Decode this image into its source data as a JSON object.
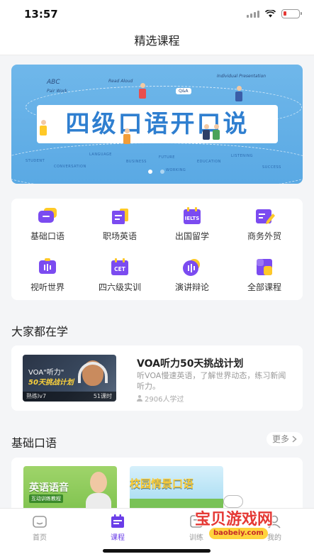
{
  "status_bar": {
    "time": "13:57"
  },
  "header": {
    "title": "精选课程"
  },
  "banner": {
    "title": "四级口语开口说",
    "small_texts": [
      "ABC",
      "Pair Work",
      "Read Aloud",
      "Individual Presentation",
      "Q&A"
    ],
    "words": [
      "STUDENT",
      "CONVERSATION",
      "LANGUAGE",
      "BUSINESS",
      "FUTURE",
      "WORKING",
      "EDUCATION",
      "LISTENING",
      "SUCCESS"
    ],
    "page_count": 2,
    "active_page": 1
  },
  "categories": [
    {
      "label": "基础口语",
      "icon": "chat-bubble-icon",
      "badge": ""
    },
    {
      "label": "职场英语",
      "icon": "briefcase-doc-icon",
      "badge": ""
    },
    {
      "label": "出国留学",
      "icon": "ielts-calendar-icon",
      "badge": "IELTS"
    },
    {
      "label": "商务外贸",
      "icon": "edit-doc-icon",
      "badge": ""
    },
    {
      "label": "视听世界",
      "icon": "tv-icon",
      "badge": ""
    },
    {
      "label": "四六级实训",
      "icon": "cet-calendar-icon",
      "badge": "CET"
    },
    {
      "label": "演讲辩论",
      "icon": "voice-wave-icon",
      "badge": ""
    },
    {
      "label": "全部课程",
      "icon": "all-courses-icon",
      "badge": ""
    }
  ],
  "popular": {
    "section_title": "大家都在学",
    "course": {
      "title": "VOA听力50天挑战计划",
      "description": "听VOA慢速英语，了解世界动态，练习新闻听力。",
      "learners": "2906人学过",
      "thumb_title": "VOA\"听力\"",
      "thumb_subtitle": "50天挑战计划",
      "level": "熟练lv7",
      "lessons": "51课时"
    }
  },
  "basic": {
    "section_title": "基础口语",
    "more_label": "更多",
    "cards": [
      {
        "title": "英语语音",
        "subtitle": "互动训练教程"
      },
      {
        "title": "校园情景口语",
        "subtitle": ""
      }
    ]
  },
  "tabbar": {
    "tabs": [
      {
        "label": "首页",
        "icon": "home-icon",
        "active": false
      },
      {
        "label": "课程",
        "icon": "course-calendar-icon",
        "active": true
      },
      {
        "label": "训练",
        "icon": "practice-icon",
        "active": false
      },
      {
        "label": "我的",
        "icon": "profile-icon",
        "active": false
      }
    ]
  },
  "watermark": {
    "text": "宝贝游戏网",
    "url": "baobeiy.com"
  },
  "colors": {
    "accent": "#6a3de8",
    "banner_blue": "#5aa9e4",
    "icon_purple": "#7b4bf0",
    "icon_yellow": "#ffc928"
  }
}
